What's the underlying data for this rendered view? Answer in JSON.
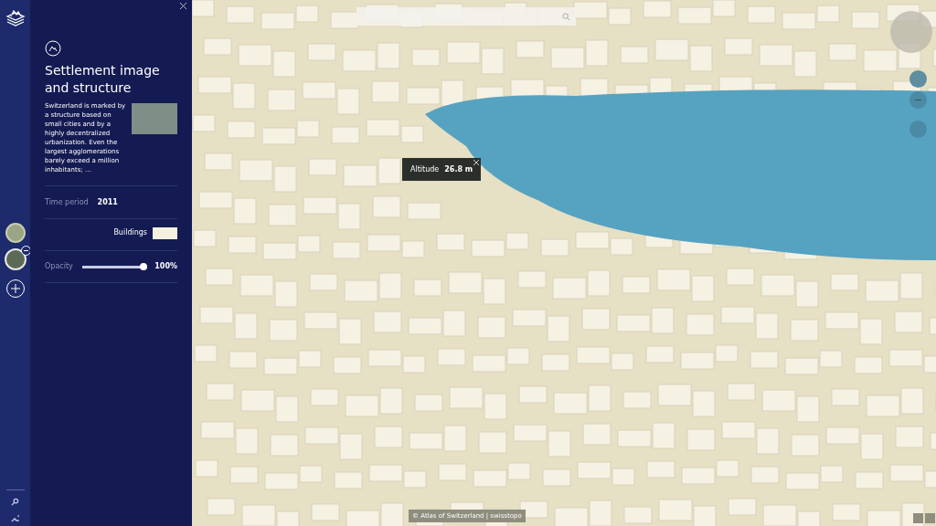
{
  "layer_rail": {
    "layers": [
      {
        "kind": "terrain"
      },
      {
        "kind": "globe",
        "removable": true
      }
    ]
  },
  "panel": {
    "title": "Settlement image and structure",
    "description": "Switzerland is marked by a structure based on small cities and by a highly decentralized urbanization. Even the largest agglomerations barely exceed a million inhabitants; …",
    "time_period": {
      "label": "Time period",
      "value": "2011"
    },
    "legend": [
      {
        "label": "Buildings",
        "color": "#f6f0df"
      }
    ],
    "opacity": {
      "label": "Opacity",
      "level": 1,
      "reading": "100%"
    }
  },
  "map": {
    "tooltip": {
      "label": "Altitude",
      "value": "26.8 m"
    },
    "attribution": "© Atlas of Switzerland | swisstopo"
  }
}
